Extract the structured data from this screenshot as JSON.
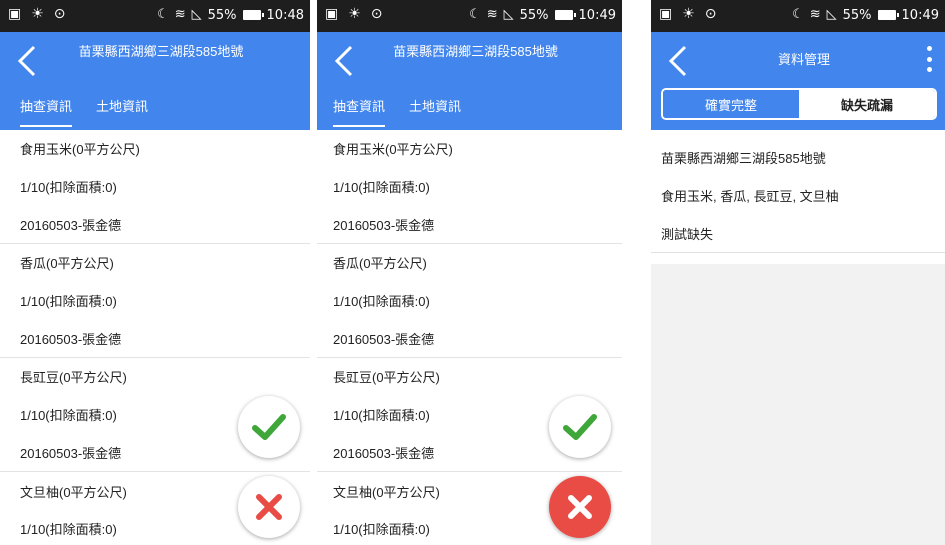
{
  "colors": {
    "header": "#4285ec",
    "check": "#3fa63a",
    "cross": "#e94b45"
  },
  "address": "苗栗縣西湖鄉三湖段585地號",
  "tabs": {
    "survey": "抽查資訊",
    "land": "土地資訊"
  },
  "screens": [
    {
      "time": "10:48",
      "battery": "55%"
    },
    {
      "time": "10:49",
      "battery": "55%"
    },
    {
      "time": "10:49",
      "battery": "55%"
    }
  ],
  "crops": [
    {
      "name": "食用玉米(0平方公尺)",
      "ratio": "1/10(扣除面積:0)",
      "record": "20160503-張金德"
    },
    {
      "name": "香瓜(0平方公尺)",
      "ratio": "1/10(扣除面積:0)",
      "record": "20160503-張金德"
    },
    {
      "name": "長豇豆(0平方公尺)",
      "ratio": "1/10(扣除面積:0)",
      "record": "20160503-張金德"
    },
    {
      "name": "文旦柚(0平方公尺)",
      "ratio": "1/10(扣除面積:0)",
      "record": ""
    }
  ],
  "manage": {
    "title": "資料管理",
    "seg_complete": "確實完整",
    "seg_missing": "缺失疏漏",
    "address": "苗栗縣西湖鄉三湖段585地號",
    "crops": "食用玉米, 香瓜, 長豇豆, 文旦柚",
    "note": "測試缺失"
  },
  "icons": [
    "back-arrow-icon",
    "check-icon",
    "cross-icon",
    "kebab-menu-icon",
    "wifi-icon",
    "battery-icon"
  ]
}
